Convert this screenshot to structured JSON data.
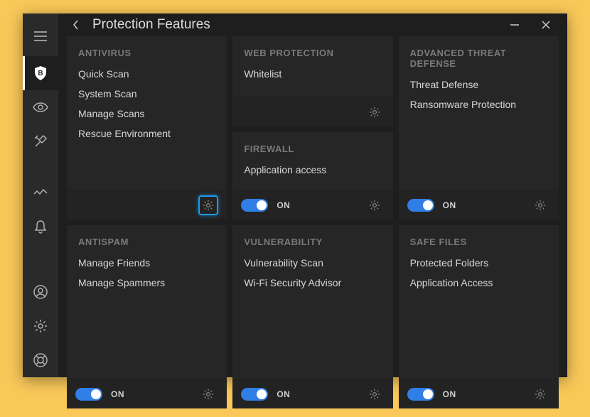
{
  "header": {
    "title": "Protection Features"
  },
  "cards": {
    "antivirus": {
      "title": "ANTIVIRUS",
      "items": [
        "Quick Scan",
        "System Scan",
        "Manage Scans",
        "Rescue Environment"
      ]
    },
    "antispam": {
      "title": "ANTISPAM",
      "items": [
        "Manage Friends",
        "Manage Spammers"
      ],
      "toggle": "ON"
    },
    "webprotection": {
      "title": "WEB PROTECTION",
      "items": [
        "Whitelist"
      ]
    },
    "firewall": {
      "title": "FIREWALL",
      "items": [
        "Application access"
      ],
      "toggle": "ON"
    },
    "vulnerability": {
      "title": "VULNERABILITY",
      "items": [
        "Vulnerability Scan",
        "Wi-Fi Security Advisor"
      ],
      "toggle": "ON"
    },
    "atd": {
      "title": "ADVANCED THREAT DEFENSE",
      "items": [
        "Threat Defense",
        "Ransomware Protection"
      ],
      "toggle": "ON"
    },
    "safefiles": {
      "title": "SAFE FILES",
      "items": [
        "Protected Folders",
        "Application Access"
      ],
      "toggle": "ON"
    }
  }
}
